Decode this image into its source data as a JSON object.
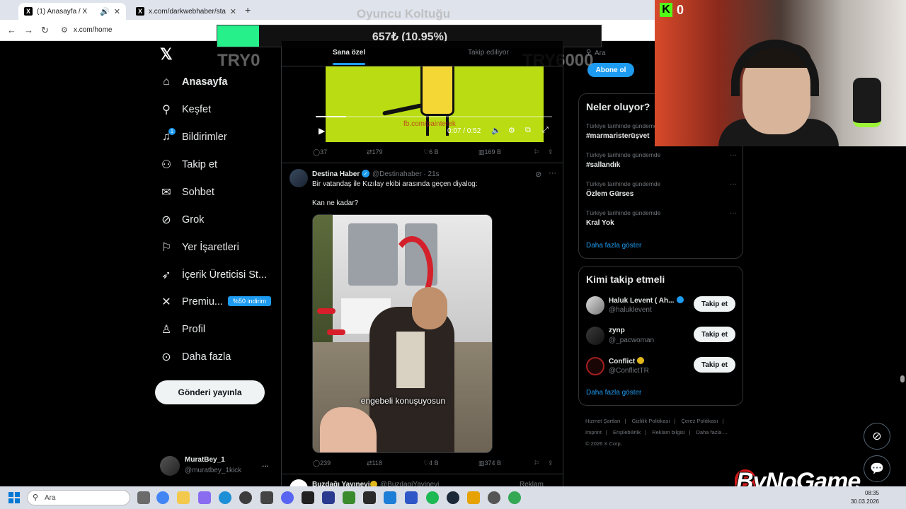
{
  "browser": {
    "tabs": [
      {
        "title": "(1) Anasayfa / X",
        "active": true
      },
      {
        "title": "x.com/darkwebhaber/status/20",
        "active": false
      }
    ],
    "url": "x.com/home"
  },
  "nav": {
    "items": [
      {
        "label": "Anasayfa",
        "icon": "home-icon"
      },
      {
        "label": "Keşfet",
        "icon": "search-icon"
      },
      {
        "label": "Bildirimler",
        "icon": "bell-icon",
        "count": "1"
      },
      {
        "label": "Takip et",
        "icon": "add-user-icon"
      },
      {
        "label": "Sohbet",
        "icon": "mail-icon"
      },
      {
        "label": "Grok",
        "icon": "grok-icon"
      },
      {
        "label": "Yer İşaretleri",
        "icon": "bookmark-icon"
      },
      {
        "label": "İçerik Üreticisi St...",
        "icon": "rocket-icon"
      },
      {
        "label": "Premiu...",
        "icon": "x-icon"
      },
      {
        "label": "Profil",
        "icon": "person-icon"
      },
      {
        "label": "Daha fazla",
        "icon": "more-circle-icon"
      }
    ],
    "premium_badge": "%50 indirim",
    "post_button": "Gönderi yayınla",
    "account": {
      "name": "MuratBey_1",
      "handle": "@muratbey_1kick",
      "more": "..."
    }
  },
  "feed": {
    "tabs": [
      "Sana özel",
      "Takip ediliyor"
    ],
    "post1": {
      "video_time": "0:07 / 0:52",
      "video_progress": 0.13,
      "watermark": "fb.com/painterek",
      "replies": "37",
      "reposts": "179",
      "likes": "6 B",
      "views": "169 B"
    },
    "post2": {
      "name": "Destina Haber",
      "handle": "@Destinahaber · 21s",
      "text1": "Bir vatandaş ile Kızılay ekibi arasında geçen diyalog:",
      "text2": "Kan ne kadar?",
      "caption": "engebeli konuşuyosun",
      "replies": "239",
      "reposts": "118",
      "likes": "4 B",
      "views": "374 B"
    },
    "post3": {
      "name": "Buzdağı Yayınevi",
      "handle": "@BuzdagiYayinevi",
      "ad": "Reklam"
    }
  },
  "sidebar": {
    "search_placeholder": "Ara",
    "subscribe": "Abone ol",
    "trends_title": "Neler oluyor?",
    "trends": [
      {
        "context": "Türkiye tarihinde gündemde",
        "name": "#marmaristerüşvet"
      },
      {
        "context": "Türkiye tarihinde gündemde",
        "name": "#sallandık"
      },
      {
        "context": "Türkiye tarihinde gündemde",
        "name": "Özlem Gürses"
      },
      {
        "context": "Türkiye tarihinde gündemde",
        "name": "Kral Yok"
      }
    ],
    "show_more": "Daha fazla göster",
    "follow_title": "Kimi takip etmeli",
    "suggestions": [
      {
        "name": "Haluk Levent ( Ah...",
        "handle": "@haluklevent",
        "button": "Takip et",
        "badge": "blue"
      },
      {
        "name": "zynp",
        "handle": "@_pacwoman",
        "button": "Takip et",
        "badge": "none"
      },
      {
        "name": "Conflict",
        "handle": "@ConflictTR",
        "button": "Takip et",
        "badge": "gold"
      }
    ],
    "follow_show_more": "Daha fazla göster",
    "footer": [
      "Hizmet Şartları",
      "|",
      "Gizlilik Politikası",
      "|",
      "Çerez Politikası",
      "|",
      "Imprint",
      "|",
      "Erişilebilirlik",
      "|",
      "Reklam bilgisi",
      "|",
      "Daha fazla ...",
      "© 2026 X Corp."
    ]
  },
  "overlay": {
    "title": "Oyuncu Koltuğu",
    "amount": "657₺ (10.95%)",
    "progress": 0.1095,
    "min": "TRY0",
    "max": "TRY6000",
    "accent": "#26f08a"
  },
  "stream": {
    "kick_count": "0",
    "watermark": "ByNoGame"
  },
  "taskbar": {
    "search": "Ara",
    "time": "08:35",
    "date": "30.03.2026"
  }
}
